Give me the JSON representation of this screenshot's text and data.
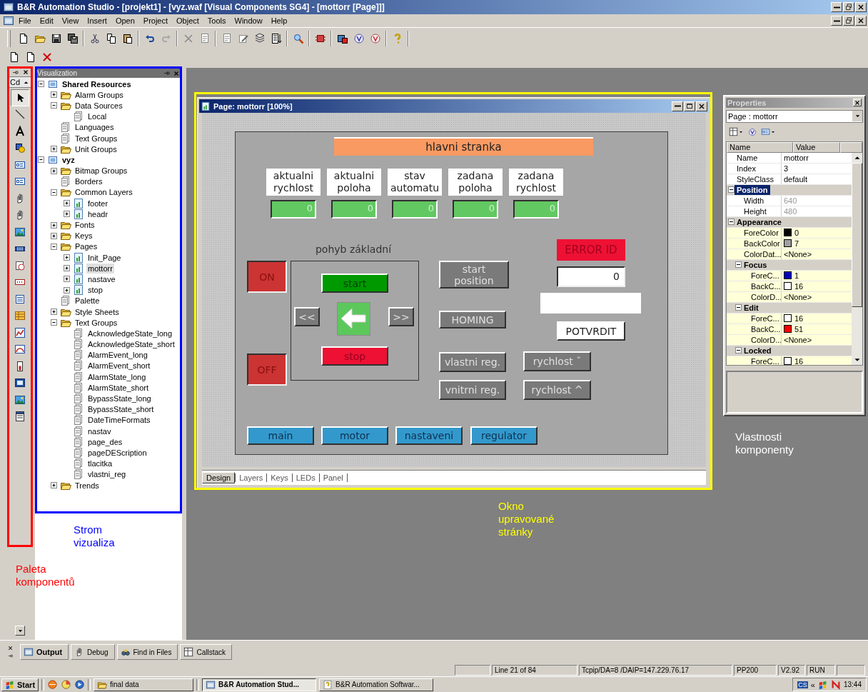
{
  "window": {
    "title": "B&R Automation Studio - [projekt1] - [vyz.waf [Visual Components SG4] - [mottorr [Page]]]"
  },
  "menu": [
    "File",
    "Edit",
    "View",
    "Insert",
    "Open",
    "Project",
    "Object",
    "Tools",
    "Window",
    "Help"
  ],
  "palette": {
    "combo": "Cd"
  },
  "tree_panel": {
    "title": "Visualization",
    "items": [
      {
        "label": "Shared Resources",
        "expanded": true,
        "selected": false,
        "children": [
          {
            "label": "Alarm Groups",
            "expanded": false,
            "selected": false
          },
          {
            "label": "Data Sources",
            "expanded": true,
            "selected": false,
            "children": [
              {
                "label": "Local",
                "selected": false
              }
            ]
          },
          {
            "label": "Languages",
            "selected": false
          },
          {
            "label": "Text Groups",
            "selected": false
          },
          {
            "label": "Unit Groups",
            "expanded": false,
            "selected": false
          }
        ]
      },
      {
        "label": "vyz",
        "expanded": true,
        "selected": false,
        "children": [
          {
            "label": "Bitmap Groups",
            "expanded": false,
            "selected": false
          },
          {
            "label": "Borders",
            "selected": false
          },
          {
            "label": "Common Layers",
            "expanded": true,
            "selected": false,
            "children": [
              {
                "label": "footer",
                "expanded": false,
                "selected": false
              },
              {
                "label": "headr",
                "expanded": false,
                "selected": false
              }
            ]
          },
          {
            "label": "Fonts",
            "expanded": false,
            "selected": false
          },
          {
            "label": "Keys",
            "expanded": false,
            "selected": false
          },
          {
            "label": "Pages",
            "expanded": true,
            "selected": false,
            "children": [
              {
                "label": "Init_Page",
                "expanded": false,
                "selected": false
              },
              {
                "label": "mottorr",
                "expanded": false,
                "selected": true
              },
              {
                "label": "nastave",
                "expanded": false,
                "selected": false
              },
              {
                "label": "stop",
                "expanded": false,
                "selected": false
              }
            ]
          },
          {
            "label": "Palette",
            "selected": false
          },
          {
            "label": "Style Sheets",
            "expanded": false,
            "selected": false
          },
          {
            "label": "Text Groups",
            "expanded": true,
            "selected": false,
            "children": [
              {
                "label": "AcknowledgeState_long",
                "selected": false
              },
              {
                "label": "AcknowledgeState_short",
                "selected": false
              },
              {
                "label": "AlarmEvent_long",
                "selected": false
              },
              {
                "label": "AlarmEvent_short",
                "selected": false
              },
              {
                "label": "AlarmState_long",
                "selected": false
              },
              {
                "label": "AlarmState_short",
                "selected": false
              },
              {
                "label": "BypassState_long",
                "selected": false
              },
              {
                "label": "BypassState_short",
                "selected": false
              },
              {
                "label": "DateTimeFormats",
                "selected": false
              },
              {
                "label": "nastav",
                "selected": false
              },
              {
                "label": "page_des",
                "selected": false
              },
              {
                "label": "pageDEScription",
                "selected": false
              },
              {
                "label": "tlacitka",
                "selected": false
              },
              {
                "label": "vlastni_reg",
                "selected": false
              }
            ]
          },
          {
            "label": "Trends",
            "expanded": false,
            "selected": false
          }
        ]
      }
    ]
  },
  "page_window": {
    "title": "Page: mottorr [100%]",
    "tabs": [
      {
        "label": "Design",
        "selected": true
      },
      {
        "label": "Layers",
        "selected": false
      },
      {
        "label": "Keys",
        "selected": false
      },
      {
        "label": "LEDs",
        "selected": false
      },
      {
        "label": "Panel",
        "selected": false
      }
    ],
    "canvas": {
      "header": "hlavni stranka",
      "readouts": [
        {
          "label": "aktualni rychlost",
          "value": "0"
        },
        {
          "label": "aktualni poloha",
          "value": "0"
        },
        {
          "label": "stav automatu",
          "value": "0"
        },
        {
          "label": "zadana poloha",
          "value": "0"
        },
        {
          "label": "zadana rychlost",
          "value": "0"
        }
      ],
      "motion": {
        "title": "pohyb základní",
        "start": "start",
        "left": "<<",
        "right": ">>",
        "stop": "stop"
      },
      "on": "ON",
      "off": "OFF",
      "buttons": [
        "start position",
        "HOMING",
        "vlastni reg.",
        "vnitrni reg.",
        "rychlost ˇ",
        "rychlost ^"
      ],
      "error": {
        "label": "ERROR ID",
        "value": "0",
        "confirm": "POTVRDIT"
      },
      "nav": [
        "main",
        "motor",
        "nastaveni",
        "regulator"
      ]
    }
  },
  "properties": {
    "title": "Properties",
    "object": "Page : mottorr",
    "columns": [
      "Name",
      "Value"
    ],
    "rows": [
      {
        "kind": "property",
        "name": "Name",
        "value": "mottorr",
        "disabled": false,
        "selected": false
      },
      {
        "kind": "property",
        "name": "Index",
        "value": "3",
        "disabled": false,
        "selected": false
      },
      {
        "kind": "property",
        "name": "StyleClass",
        "value": "default",
        "disabled": false,
        "selected": false
      },
      {
        "kind": "group",
        "name": "Position",
        "expanded": true,
        "selected": true,
        "children": [
          {
            "kind": "property",
            "name": "Width",
            "value": "640",
            "disabled": true,
            "selected": false
          },
          {
            "kind": "property",
            "name": "Height",
            "value": "480",
            "disabled": true,
            "selected": false
          }
        ]
      },
      {
        "kind": "group",
        "name": "Appearance",
        "expanded": true,
        "selected": false,
        "children": [
          {
            "kind": "color",
            "name": "ForeColor",
            "value": "0",
            "color": "#000000",
            "disabled": false,
            "selected": false
          },
          {
            "kind": "color",
            "name": "BackColor",
            "value": "7",
            "color": "#a0a0a0",
            "disabled": false,
            "selected": false
          },
          {
            "kind": "color",
            "name": "ColorDat...",
            "value": "<None>",
            "disabled": false,
            "selected": false
          },
          {
            "kind": "group",
            "name": "Focus",
            "expanded": true,
            "selected": false,
            "children": [
              {
                "kind": "color",
                "name": "ForeC...",
                "value": "1",
                "color": "#0000c0",
                "disabled": false,
                "selected": false
              },
              {
                "kind": "color",
                "name": "BackC...",
                "value": "16",
                "color": "#ffffff",
                "disabled": false,
                "selected": false
              },
              {
                "kind": "color",
                "name": "ColorD...",
                "value": "<None>",
                "disabled": false,
                "selected": false
              }
            ]
          },
          {
            "kind": "group",
            "name": "Edit",
            "expanded": true,
            "selected": false,
            "children": [
              {
                "kind": "color",
                "name": "ForeC...",
                "value": "16",
                "color": "#ffffff",
                "disabled": false,
                "selected": false
              },
              {
                "kind": "color",
                "name": "BackC...",
                "value": "51",
                "color": "#ff0000",
                "disabled": false,
                "selected": false
              },
              {
                "kind": "color",
                "name": "ColorD...",
                "value": "<None>",
                "disabled": false,
                "selected": false
              }
            ]
          },
          {
            "kind": "group",
            "name": "Locked",
            "expanded": true,
            "selected": false,
            "children": [
              {
                "kind": "color",
                "name": "ForeC...",
                "value": "16",
                "color": "#ffffff",
                "disabled": false,
                "selected": false
              }
            ]
          }
        ]
      }
    ]
  },
  "annotations": [
    {
      "text": "Strom vizualiza",
      "color": "#0000ff"
    },
    {
      "text": "Paleta komponentů",
      "color": "#ff0000"
    },
    {
      "text": "Okno upravované stránky",
      "color": "#ffff00"
    },
    {
      "text": "Vlastnosti komponenty",
      "color": "#ffffff"
    }
  ],
  "frames": [
    {
      "color": "#ff0000"
    },
    {
      "color": "#0000ff"
    },
    {
      "color": "#ffff00"
    }
  ],
  "output_tabs": [
    {
      "label": "Output",
      "selected": true
    },
    {
      "label": "Debug",
      "selected": false
    },
    {
      "label": "Find in Files",
      "selected": false
    },
    {
      "label": "Callstack",
      "selected": false
    }
  ],
  "status_bar": [
    "Line 21 of 84",
    "Tcpip/DA=8 /DAIP=147.229.76.17",
    "PP200",
    "V2.92",
    "RUN"
  ],
  "taskbar": {
    "start": "Start",
    "folder": "final data",
    "windows": [
      {
        "label": "B&R Automation Stud...",
        "selected": true
      },
      {
        "label": "B&R Automation Softwar...",
        "selected": false
      }
    ],
    "language": "CS",
    "expand": "«",
    "time": "13:44"
  }
}
